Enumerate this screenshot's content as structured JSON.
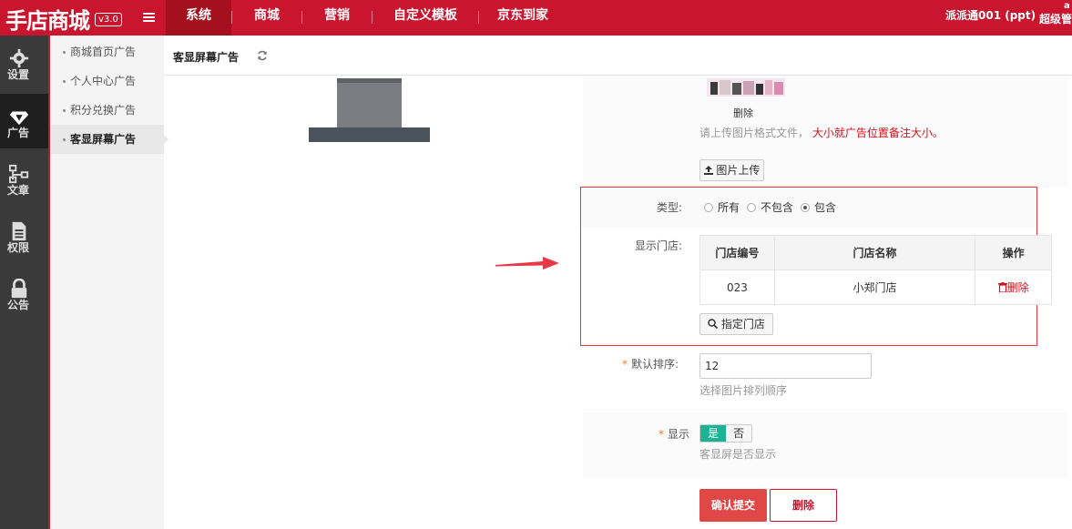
{
  "header": {
    "logo_text": "手店商城",
    "version": "v3.0",
    "nav": [
      {
        "label": "系统",
        "active": true
      },
      {
        "label": "商城",
        "active": false
      },
      {
        "label": "营销",
        "active": false
      },
      {
        "label": "自定义模板",
        "active": false
      },
      {
        "label": "京东到家",
        "active": false
      }
    ],
    "user_name": "派派通001 (ppt)",
    "user_role": "超级管",
    "user_top": "a"
  },
  "iconbar": {
    "items": [
      {
        "label": "设置",
        "icon": "gear-icon"
      },
      {
        "label": "广告",
        "icon": "diamond-icon",
        "active": true
      },
      {
        "label": "文章",
        "icon": "sitemap-icon"
      },
      {
        "label": "权限",
        "icon": "document-icon"
      },
      {
        "label": "公告",
        "icon": "lock-icon"
      }
    ]
  },
  "submenu": {
    "items": [
      {
        "label": "商城首页广告"
      },
      {
        "label": "个人中心广告"
      },
      {
        "label": "积分兑换广告"
      },
      {
        "label": "客显屏幕广告",
        "active": true
      }
    ]
  },
  "page": {
    "title": "客显屏幕广告"
  },
  "image_section": {
    "delete_label": "删除",
    "hint": "请上传图片格式文件，",
    "hint_warning": "大小就广告位置备注大小。",
    "upload_button": "图片上传"
  },
  "type_field": {
    "label": "类型:",
    "options": [
      "所有",
      "不包含",
      "包含"
    ],
    "selected": "包含"
  },
  "stores_field": {
    "label": "显示门店:",
    "columns": [
      "门店编号",
      "门店名称",
      "操作"
    ],
    "rows": [
      {
        "code": "023",
        "name": "小郑门店",
        "action": "删除"
      }
    ],
    "assign_button": "指定门店"
  },
  "sort_field": {
    "label": "默认排序:",
    "value": "12",
    "hint": "选择图片排列顺序"
  },
  "display_field": {
    "label": "显示",
    "on_label": "是",
    "off_label": "否",
    "value": "是",
    "hint": "客显屏是否显示"
  },
  "actions": {
    "submit": "确认提交",
    "delete": "删除"
  },
  "colors": {
    "brand_red": "#c9152e",
    "toggle_green": "#1ab394",
    "highlight_border": "#e53945"
  }
}
